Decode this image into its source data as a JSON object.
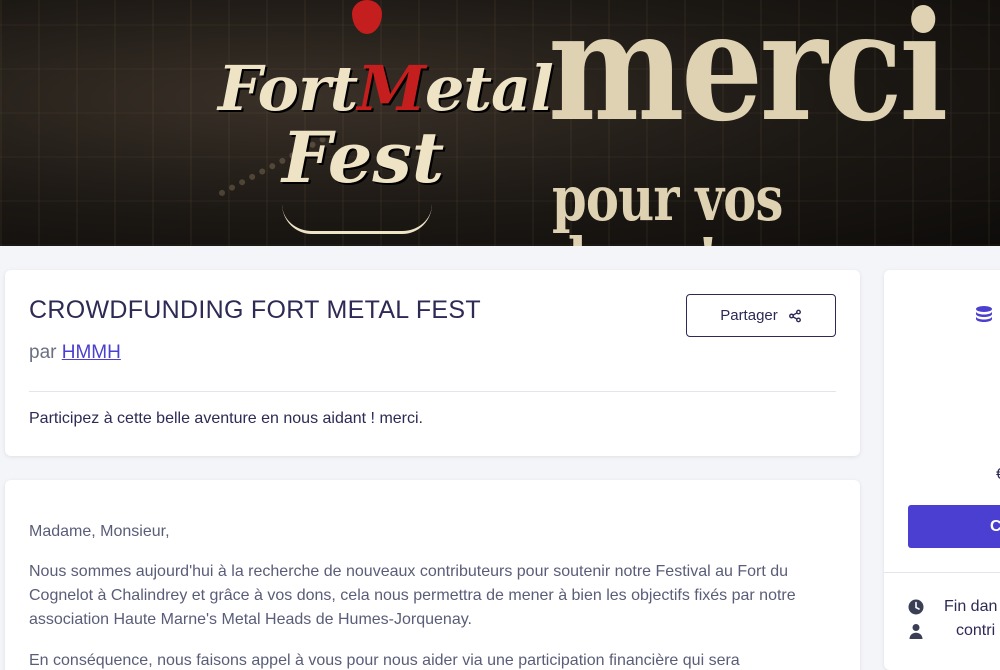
{
  "banner": {
    "logo_part1": "Fort",
    "logo_m": "M",
    "logo_part2": "etal",
    "logo_line2": "Fest",
    "headline": "merci",
    "subline": "pour vos dons !"
  },
  "campaign": {
    "title": "CROWDFUNDING FORT METAL FEST",
    "by_prefix": "par",
    "author": "HMMH",
    "share_label": "Partager",
    "tagline": "Participez à cette belle aventure en nous aidant ! merci."
  },
  "description": {
    "paragraphs": [
      "Madame, Monsieur,",
      "Nous sommes aujourd'hui à la recherche de nouveaux contributeurs pour soutenir notre Festival au Fort du Cognelot à Chalindrey et grâce à vos dons, cela nous permettra de mener à bien les objectifs fixés par notre association Haute Marne's Metal Heads de Humes-Jorquenay.",
      "En conséquence, nous faisons appel à vous pour nous aider via une participation financière qui sera"
    ]
  },
  "sidebar": {
    "partial_value": "€",
    "cta_label": "C",
    "end_text": "Fin dan",
    "contributors_text": "contri"
  },
  "colors": {
    "accent": "#4a3fd0",
    "text": "#2d2a55",
    "background": "#f4f5f9"
  },
  "icons": {
    "share": "share-icon",
    "coins": "coins-icon",
    "clock": "clock-icon",
    "user": "user-icon"
  }
}
